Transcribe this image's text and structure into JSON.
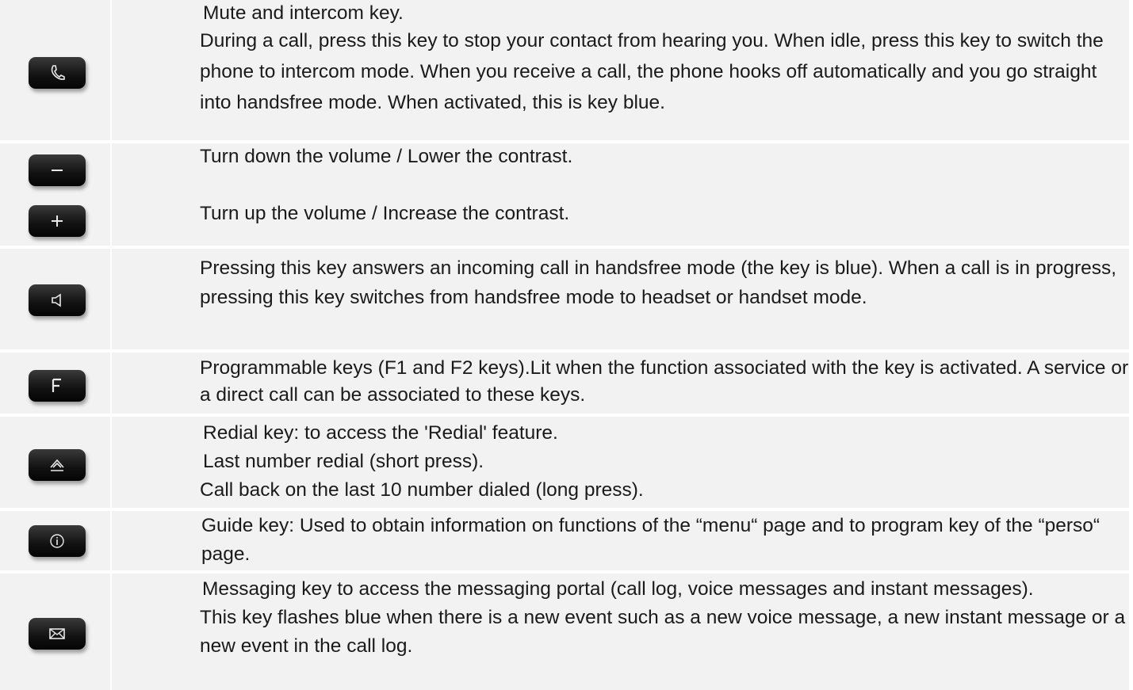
{
  "rows": [
    {
      "icon": "mute-intercom-key-icon",
      "lines": [
        "Mute and intercom key.",
        "During a call, press this key to stop your contact from hearing you. When idle, press this key to switch the phone to intercom mode. When you receive a call, the phone hooks off automatically and you go straight into handsfree mode. When activated, this is key blue."
      ]
    },
    {
      "icons": [
        "volume-down-key-icon",
        "volume-up-key-icon"
      ],
      "lines": [
        "Turn down the volume / Lower the contrast.",
        "Turn up the volume / Increase the contrast."
      ]
    },
    {
      "icon": "speaker-key-icon",
      "lines": [
        "Pressing this key answers an incoming call in handsfree mode (the key is blue). When a call is in progress, pressing this key switches from handsfree mode to headset or handset mode."
      ]
    },
    {
      "icon": "programmable-f-key-icon",
      "lines": [
        "Programmable keys (F1 and F2 keys).Lit when the function associated with the key is activated. A service or a direct call can be associated to these keys."
      ]
    },
    {
      "icon": "redial-key-icon",
      "lines": [
        "Redial key: to access the 'Redial' feature.",
        "Last number redial (short press).",
        "Call back on the last 10 number dialed (long press)."
      ]
    },
    {
      "icon": "guide-info-key-icon",
      "lines": [
        "Guide key: Used to obtain information on functions of the “menu“ page and to program key of the “perso“ page."
      ]
    },
    {
      "icon": "messaging-envelope-key-icon",
      "lines": [
        "Messaging key to access the messaging portal (call log, voice messages and instant messages).",
        "This key flashes blue when there is a new event such as a new voice message, a new instant message or a new event in the call log."
      ]
    }
  ]
}
